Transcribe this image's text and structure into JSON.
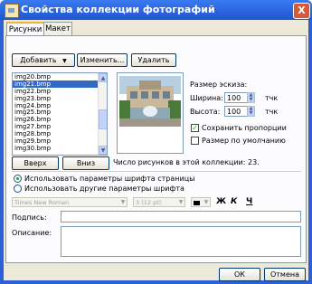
{
  "window": {
    "title": "Свойства коллекции фотографий",
    "close_glyph": "X",
    "colors": {
      "titlebar": "#2159d6",
      "face": "#ece9d8",
      "selection": "#316ac5",
      "check": "#21a121"
    }
  },
  "tabs": [
    {
      "label": "Рисунки",
      "active": true
    },
    {
      "label": "Макет",
      "active": false
    }
  ],
  "toolbar": {
    "add_label": "Добавить",
    "add_arrow": "▼",
    "edit_label": "Изменить...",
    "delete_label": "Удалить"
  },
  "pictures": {
    "items": [
      "img20.bmp",
      "img21.bmp",
      "img22.bmp",
      "img23.bmp",
      "img24.bmp",
      "img25.bmp",
      "img26.bmp",
      "img27.bmp",
      "img28.bmp",
      "img29.bmp",
      "img30.bmp"
    ],
    "selected_index": 1,
    "up_label": "Вверх",
    "down_label": "Вниз",
    "count_text": "Число рисунков в этой коллекции: 23."
  },
  "thumb_size": {
    "title": "Размер эскиза:",
    "width_label": "Ширина:",
    "width_value": "100",
    "height_label": "Высота:",
    "height_value": "100",
    "unit": "тчк",
    "keep_proportions_label": "Сохранить пропорции",
    "keep_proportions_checked": true,
    "default_size_label": "Размер по умолчанию",
    "default_size_checked": false
  },
  "font_options": {
    "use_page_label": "Использовать параметры шрифта страницы",
    "use_other_label": "Использовать другие параметры шрифта",
    "use_page_selected": true,
    "font_name": "Times New Roman",
    "font_size": "3  (12 pt)",
    "bold_glyph": "Ж",
    "italic_glyph": "К",
    "underline_glyph": "Ч"
  },
  "caption_label": "Подпись:",
  "description_label": "Описание:",
  "footer": {
    "ok_label": "ОК",
    "cancel_label": "Отмена"
  }
}
